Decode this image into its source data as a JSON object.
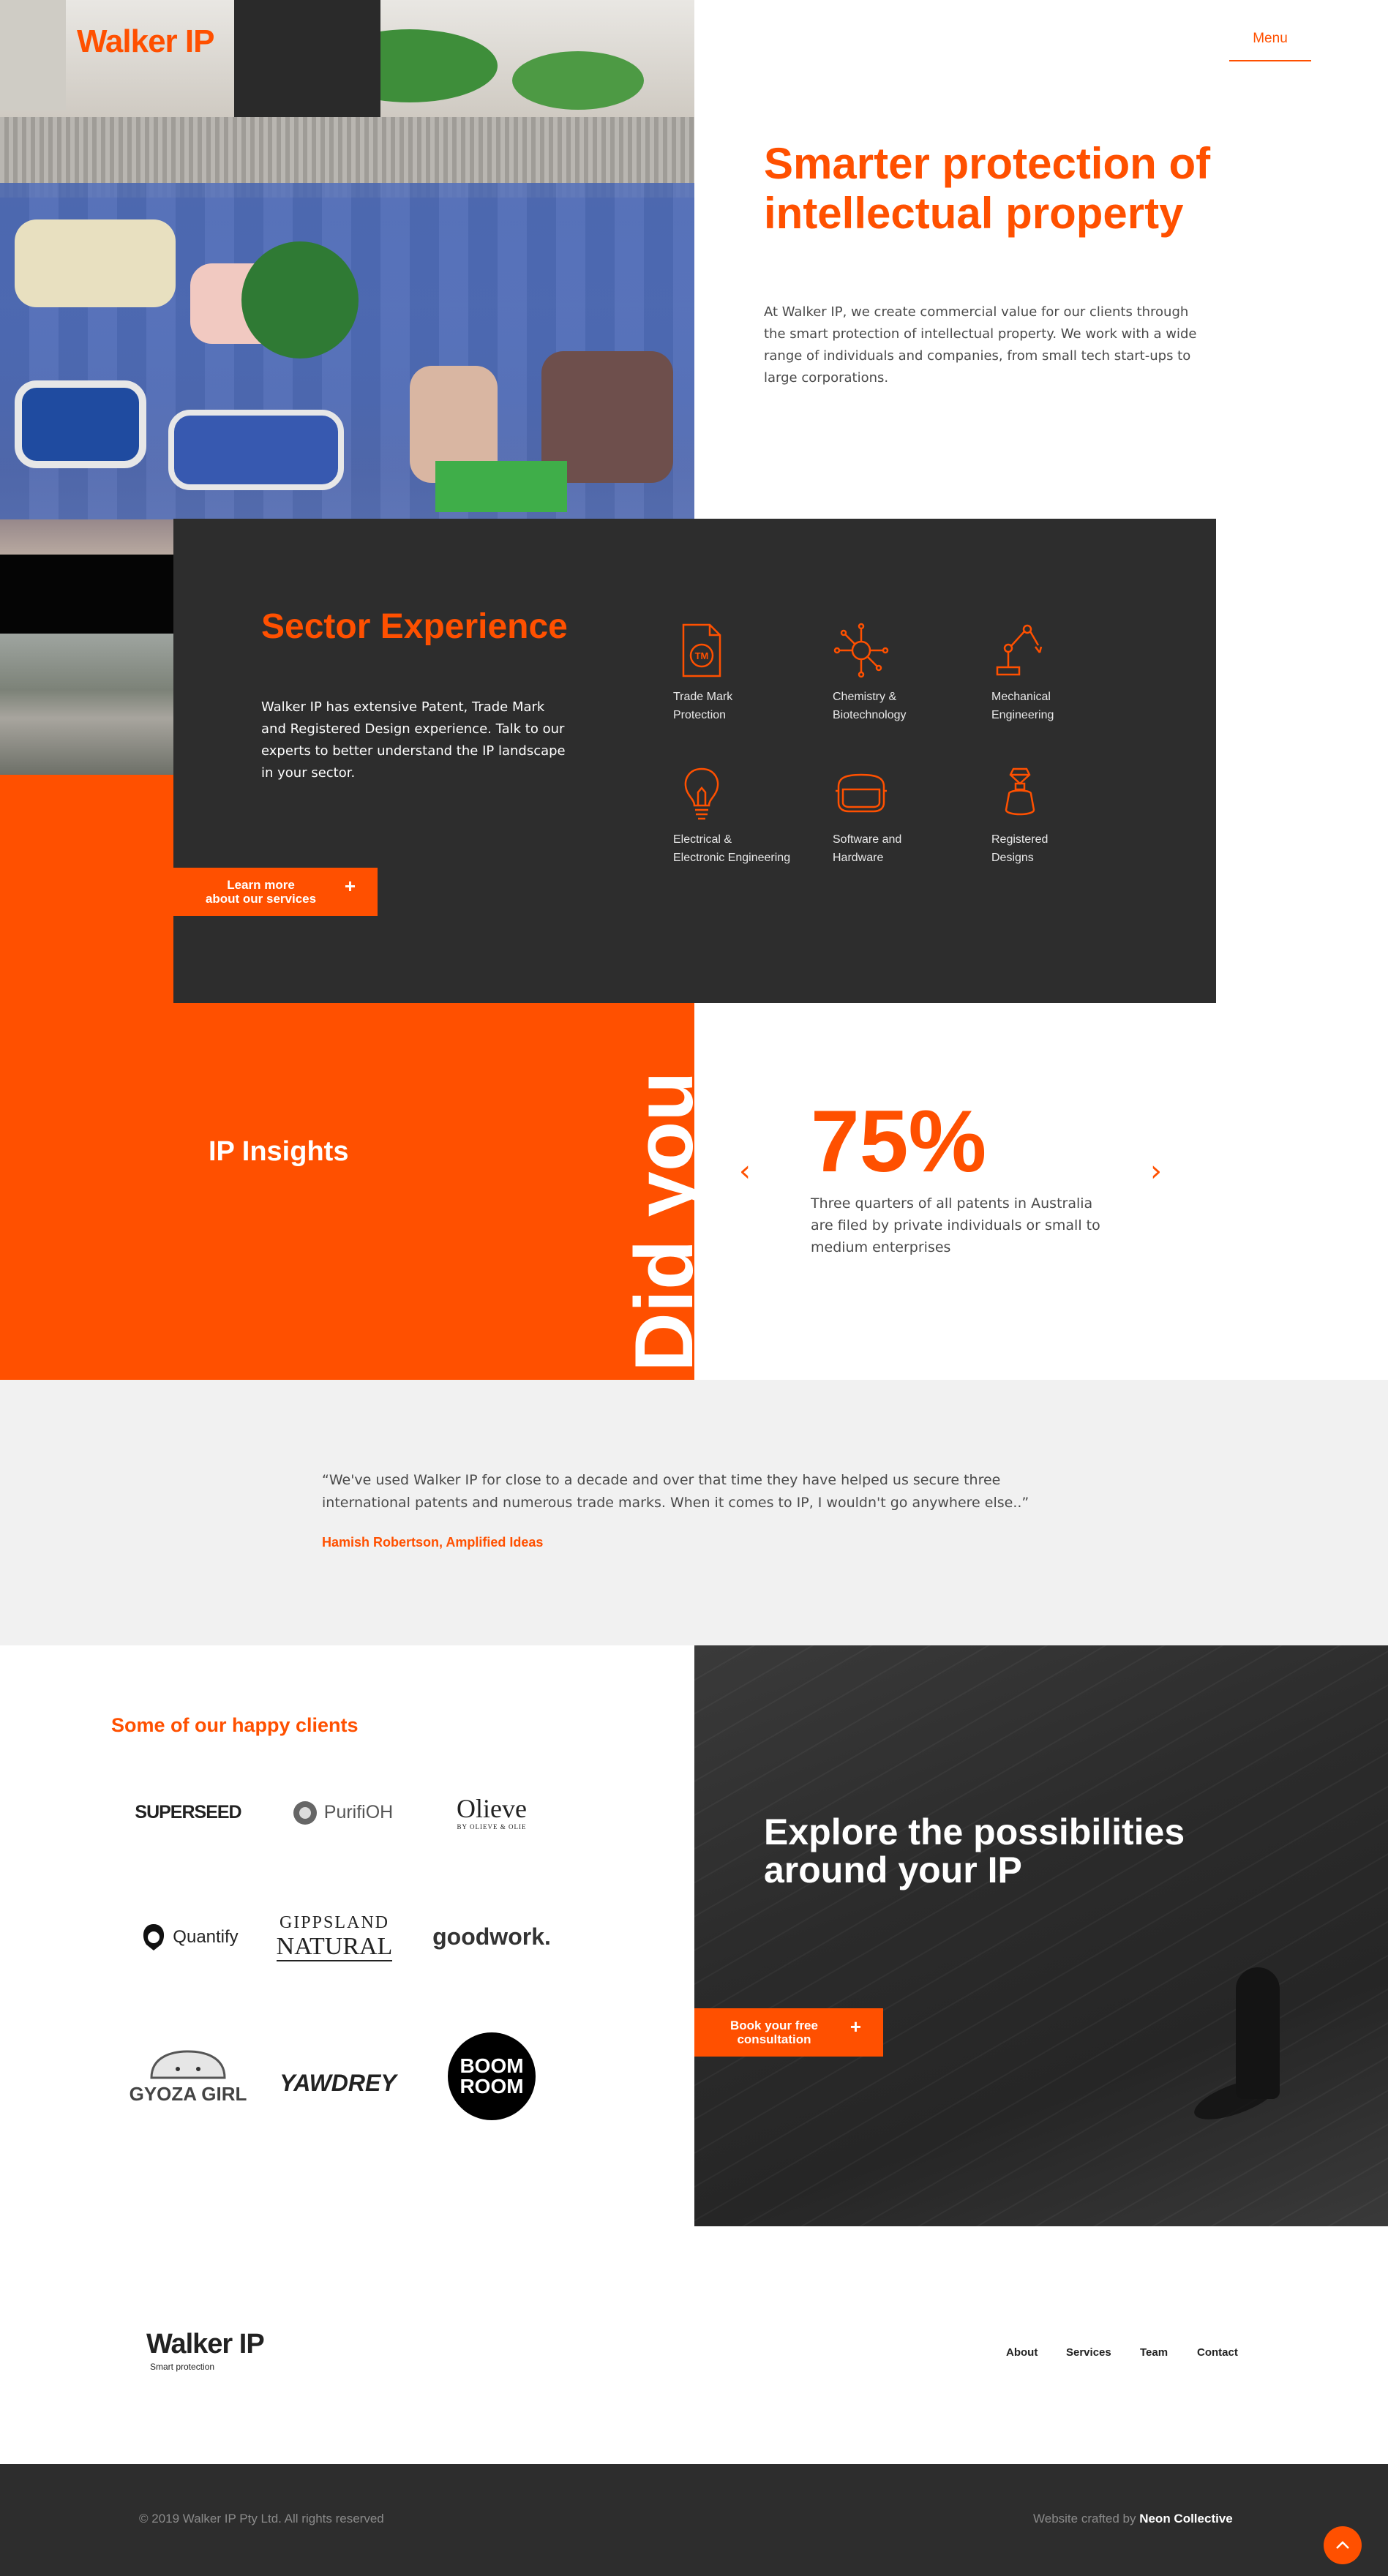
{
  "header": {
    "logo": "Walker IP",
    "menu_label": "Menu"
  },
  "hero": {
    "title": "Smarter protection of intellectual property",
    "text": "At Walker IP, we create commercial value for our clients through the smart protection of intellectual property. We work with a wide range of individuals and companies, from small tech start-ups to large corporations."
  },
  "sector": {
    "title": "Sector Experience",
    "text": "Walker IP has extensive Patent, Trade Mark and Registered Design experience. Talk to our experts to better understand the IP landscape in your sector.",
    "learn_more_line1": "Learn more",
    "learn_more_line2": "about our services",
    "plus": "+",
    "items": [
      {
        "line1": "Trade Mark",
        "line2": "Protection",
        "icon": "trade-mark-icon"
      },
      {
        "line1": "Chemistry &",
        "line2": "Biotechnology",
        "icon": "molecule-icon"
      },
      {
        "line1": "Mechanical",
        "line2": "Engineering",
        "icon": "robot-arm-icon"
      },
      {
        "line1": "Electrical &",
        "line2": "Electronic Engineering",
        "icon": "light-bulb-icon"
      },
      {
        "line1": "Software and",
        "line2": "Hardware",
        "icon": "vr-headset-icon"
      },
      {
        "line1": "Registered",
        "line2": "Designs",
        "icon": "perfume-bottle-icon"
      }
    ]
  },
  "insights": {
    "title": "IP Insights",
    "did_you_know": "Did you\nknow?",
    "prev": "‹",
    "next": "›",
    "stat_value": "75%",
    "stat_text": "Three quarters of all patents in Australia are filed by private individuals or small to medium enterprises"
  },
  "testimonial": {
    "quote": "“We've used Walker IP for close to a decade and over that time they have helped us secure three international patents and numerous trade marks. When it comes to IP, I wouldn't go anywhere else..”",
    "author": "Hamish Robertson, Amplified Ideas"
  },
  "clients": {
    "title": "Some of our happy clients",
    "logos": [
      {
        "name": "SUPERSEED"
      },
      {
        "name": "PurifiOH"
      },
      {
        "name": "Olieve",
        "sub": "BY OLIEVE & OLIE"
      },
      {
        "name": "Quantify"
      },
      {
        "name": "GIPPSLAND",
        "sub": "NATURAL"
      },
      {
        "name": "goodwork."
      },
      {
        "name": "GYOZA GIRL"
      },
      {
        "name": "YAWDREY"
      },
      {
        "name": "BOOM",
        "sub": "ROOM"
      }
    ]
  },
  "explore": {
    "title": "Explore the possibilities around your IP",
    "book_line1": "Book your free",
    "book_line2": "consultation",
    "plus": "+"
  },
  "footer": {
    "logo": "Walker IP",
    "tagline": "Smart protection",
    "links": [
      "About",
      "Services",
      "Team",
      "Contact"
    ],
    "copyright": "© 2019 Walker IP Pty Ltd. All rights reserved",
    "credit_prefix": "Website crafted by ",
    "credit_name": "Neon Collective"
  },
  "colors": {
    "accent": "#ff5000",
    "dark": "#2d2d2d",
    "light_grey": "#f1f1f1"
  }
}
